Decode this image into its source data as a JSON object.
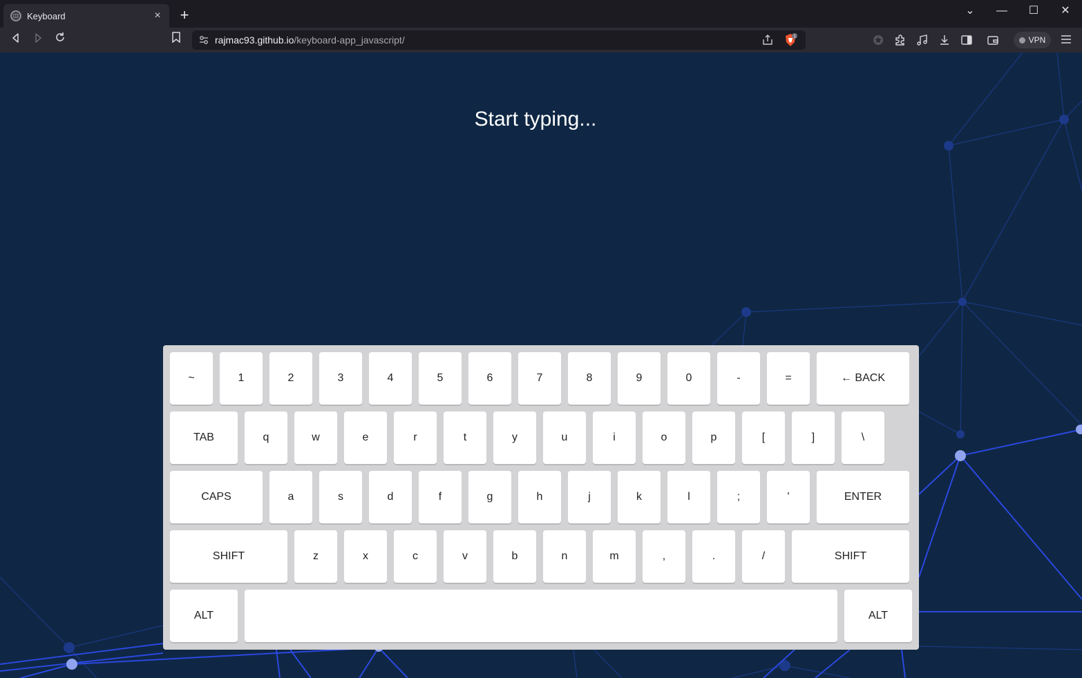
{
  "browser": {
    "tab_title": "Keyboard",
    "tab_close": "×",
    "new_tab": "+",
    "url_host": "rajmac93.github.io",
    "url_path": "/keyboard-app_javascript/",
    "vpn_label": "VPN",
    "window_controls": [
      "⌄",
      "—",
      "☐",
      "✕"
    ]
  },
  "page": {
    "heading": "Start typing..."
  },
  "keyboard": {
    "rows": [
      [
        "~",
        "1",
        "2",
        "3",
        "4",
        "5",
        "6",
        "7",
        "8",
        "9",
        "0",
        "-",
        "=",
        "← BACK"
      ],
      [
        "TAB",
        "q",
        "w",
        "e",
        "r",
        "t",
        "y",
        "u",
        "i",
        "o",
        "p",
        "[",
        "]",
        "\\"
      ],
      [
        "CAPS",
        "a",
        "s",
        "d",
        "f",
        "g",
        "h",
        "j",
        "k",
        "l",
        ";",
        "'",
        "ENTER"
      ],
      [
        "SHIFT",
        "z",
        "x",
        "c",
        "v",
        "b",
        "n",
        "m",
        ",",
        ".",
        "/",
        "SHIFT"
      ],
      [
        "ALT",
        "",
        "ALT"
      ]
    ]
  },
  "colors": {
    "page_bg": "#0f2744",
    "network_lines": "#2b48d8",
    "keyboard_bg": "#d3d3d5",
    "key_bg": "#ffffff"
  }
}
